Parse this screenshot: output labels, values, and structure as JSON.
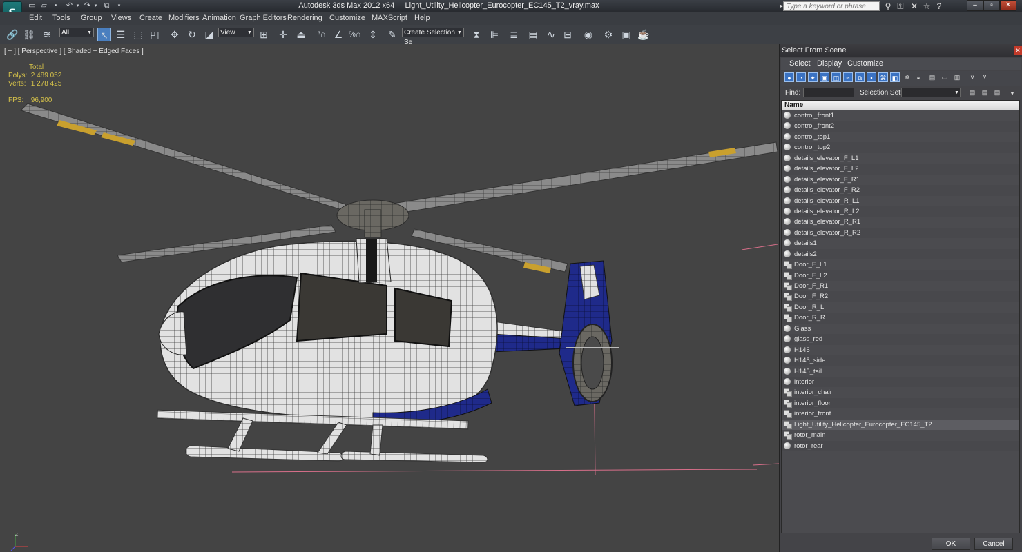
{
  "window": {
    "app_name": "Autodesk 3ds Max  2012 x64",
    "file_name": "Light_Utility_Helicopter_Eurocopter_EC145_T2_vray.max",
    "search_placeholder": "Type a keyword or phrase"
  },
  "menu": [
    "Edit",
    "Tools",
    "Group",
    "Views",
    "Create",
    "Modifiers",
    "Animation",
    "Graph Editors",
    "Rendering",
    "Customize",
    "MAXScript",
    "Help"
  ],
  "toolbar": {
    "selection_filter": "All",
    "reference_coord": "View",
    "named_selection_placeholder": "Create Selection Se"
  },
  "viewport": {
    "label": "[ + ] [ Perspective ] [ Shaded + Edged Faces ]",
    "stats": {
      "total_label": "Total",
      "polys_label": "Polys:",
      "polys_value": "2 489 052",
      "verts_label": "Verts:",
      "verts_value": "1 278 425",
      "fps_label": "FPS:",
      "fps_value": "96,900"
    },
    "axis_labels": [
      "X",
      "Y",
      "Z"
    ]
  },
  "dialog": {
    "title": "Select From Scene",
    "menu": [
      "Select",
      "Display",
      "Customize"
    ],
    "find_label": "Find:",
    "selection_set_label": "Selection Set:",
    "column_header": "Name",
    "items": [
      {
        "name": "control_front1",
        "type": "object"
      },
      {
        "name": "control_front2",
        "type": "object"
      },
      {
        "name": "control_top1",
        "type": "object"
      },
      {
        "name": "control_top2",
        "type": "object"
      },
      {
        "name": "details_elevator_F_L1",
        "type": "object"
      },
      {
        "name": "details_elevator_F_L2",
        "type": "object"
      },
      {
        "name": "details_elevator_F_R1",
        "type": "object"
      },
      {
        "name": "details_elevator_F_R2",
        "type": "object"
      },
      {
        "name": "details_elevator_R_L1",
        "type": "object"
      },
      {
        "name": "details_elevator_R_L2",
        "type": "object"
      },
      {
        "name": "details_elevator_R_R1",
        "type": "object"
      },
      {
        "name": "details_elevator_R_R2",
        "type": "object"
      },
      {
        "name": "details1",
        "type": "object"
      },
      {
        "name": "details2",
        "type": "object"
      },
      {
        "name": "Door_F_L1",
        "type": "group"
      },
      {
        "name": "Door_F_L2",
        "type": "group"
      },
      {
        "name": "Door_F_R1",
        "type": "group"
      },
      {
        "name": "Door_F_R2",
        "type": "group"
      },
      {
        "name": "Door_R_L",
        "type": "group"
      },
      {
        "name": "Door_R_R",
        "type": "group"
      },
      {
        "name": "Glass",
        "type": "object"
      },
      {
        "name": "glass_red",
        "type": "object"
      },
      {
        "name": "H145",
        "type": "object"
      },
      {
        "name": "H145_side",
        "type": "object"
      },
      {
        "name": "H145_tail",
        "type": "object"
      },
      {
        "name": "interior",
        "type": "object"
      },
      {
        "name": "interior_chair",
        "type": "group"
      },
      {
        "name": "interior_floor",
        "type": "group"
      },
      {
        "name": "interior_front",
        "type": "group"
      },
      {
        "name": "Light_Utility_Helicopter_Eurocopter_EC145_T2",
        "type": "group",
        "selected": true
      },
      {
        "name": "rotor_main",
        "type": "group"
      },
      {
        "name": "rotor_rear",
        "type": "object"
      }
    ],
    "ok_label": "OK",
    "cancel_label": "Cancel"
  },
  "colors": {
    "viewport_bg": "#444444",
    "stats_text": "#d6c24a",
    "selected_tool": "#4a7fbf",
    "livery_blue": "#1f2a8a"
  }
}
